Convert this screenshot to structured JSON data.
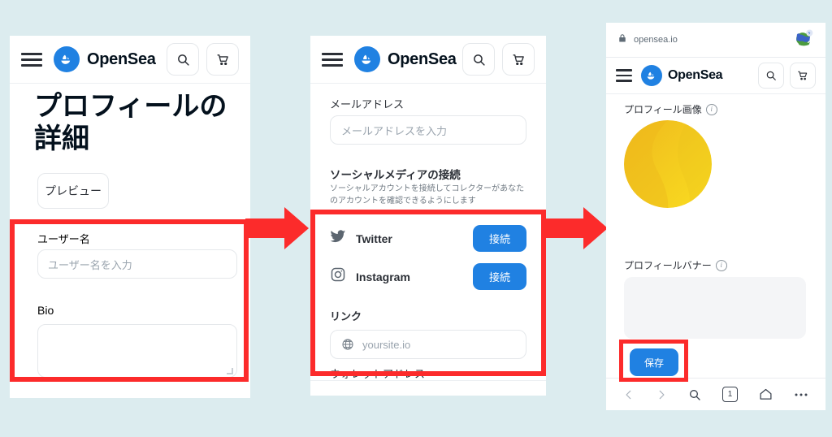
{
  "theme": {
    "background": "#dcecef",
    "opensea_blue": "#2081e2",
    "highlight_red": "#fc2b2b",
    "panel_white": "#ffffff",
    "placeholder_gray": "#9aa4ae",
    "avatar_gold": "#f2c11c"
  },
  "brand": {
    "name": "OpenSea",
    "logo_icon": "opensea-boat-logo"
  },
  "panel1": {
    "header": {
      "menu_icon": "hamburger-menu-icon",
      "brand": "OpenSea",
      "search_icon": "search-icon",
      "cart_icon": "shopping-cart-icon"
    },
    "page_title": "プロフィールの\n詳細",
    "page_title_line1": "プロフィールの",
    "page_title_line2": "詳細",
    "preview_button": "プレビュー",
    "username_label": "ユーザー名",
    "username_placeholder": "ユーザー名を入力",
    "username_value": "",
    "bio_label": "Bio",
    "bio_value": ""
  },
  "panel2": {
    "header": {
      "menu_icon": "hamburger-menu-icon",
      "brand": "OpenSea",
      "search_icon": "search-icon",
      "cart_icon": "shopping-cart-icon"
    },
    "email_label": "メールアドレス",
    "email_placeholder": "メールアドレスを入力",
    "email_value": "",
    "social_heading": "ソーシャルメディアの接続",
    "social_description_line1": "ソーシャルアカウントを接続してコレクターがあなた",
    "social_description_line2": "のアカウントを確認できるようにします",
    "socials": [
      {
        "name": "Twitter",
        "icon": "twitter-bird-icon",
        "button": "接続"
      },
      {
        "name": "Instagram",
        "icon": "instagram-camera-icon",
        "button": "接続"
      }
    ],
    "link_label": "リンク",
    "link_icon": "globe-icon",
    "link_placeholder": "yoursite.io",
    "link_value": "",
    "wallet_label": "ウォレットアドレス"
  },
  "panel3": {
    "browser": {
      "lock_icon": "padlock-icon",
      "url": "opensea.io",
      "extension_icon": "globe-extension-icon"
    },
    "header": {
      "menu_icon": "hamburger-menu-icon",
      "brand": "OpenSea",
      "search_icon": "search-icon",
      "cart_icon": "shopping-cart-icon"
    },
    "profile_image_label": "プロフィール画像",
    "profile_image_info_icon": "info-icon",
    "avatar_icon": "gold-circle-avatar",
    "profile_banner_label": "プロフィールバナー",
    "profile_banner_info_icon": "info-icon",
    "save_button": "保存",
    "bottom_nav": [
      {
        "name": "back",
        "icon": "chevron-left-icon",
        "label": ""
      },
      {
        "name": "forward",
        "icon": "chevron-right-icon",
        "label": ""
      },
      {
        "name": "search",
        "icon": "search-icon",
        "label": ""
      },
      {
        "name": "tabs",
        "icon": "tab-count-icon",
        "label": "1"
      },
      {
        "name": "home",
        "icon": "home-icon",
        "label": ""
      },
      {
        "name": "more",
        "icon": "ellipsis-icon",
        "label": ""
      }
    ]
  },
  "flow": {
    "arrow1_icon": "right-arrow-icon",
    "arrow2_icon": "right-arrow-icon"
  }
}
